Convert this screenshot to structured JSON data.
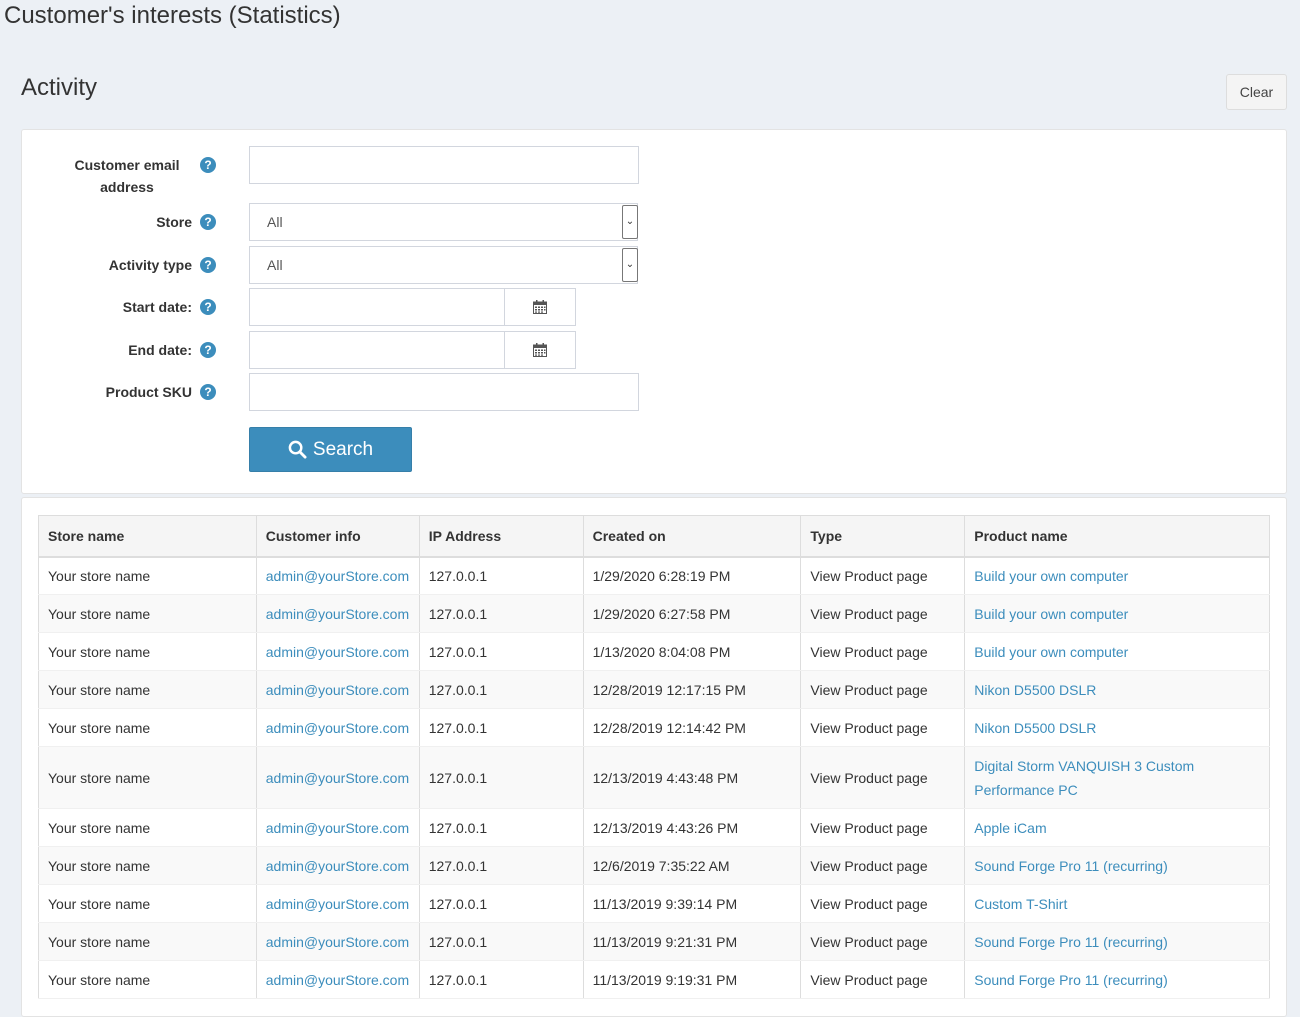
{
  "page": {
    "title": "Customer's interests (Statistics)"
  },
  "section": {
    "title": "Activity",
    "clear_label": "Clear"
  },
  "filters": {
    "email": {
      "label": "Customer email address",
      "value": ""
    },
    "store": {
      "label": "Store",
      "value": "All"
    },
    "activity_type": {
      "label": "Activity type",
      "value": "All"
    },
    "start_date": {
      "label": "Start date:",
      "value": ""
    },
    "end_date": {
      "label": "End date:",
      "value": ""
    },
    "sku": {
      "label": "Product SKU",
      "value": ""
    },
    "search_label": "Search"
  },
  "table": {
    "headers": [
      "Store name",
      "Customer info",
      "IP Address",
      "Created on",
      "Type",
      "Product name"
    ],
    "rows": [
      [
        "Your store name",
        "admin@yourStore.com",
        "127.0.0.1",
        "1/29/2020 6:28:19 PM",
        "View Product page",
        "Build your own computer"
      ],
      [
        "Your store name",
        "admin@yourStore.com",
        "127.0.0.1",
        "1/29/2020 6:27:58 PM",
        "View Product page",
        "Build your own computer"
      ],
      [
        "Your store name",
        "admin@yourStore.com",
        "127.0.0.1",
        "1/13/2020 8:04:08 PM",
        "View Product page",
        "Build your own computer"
      ],
      [
        "Your store name",
        "admin@yourStore.com",
        "127.0.0.1",
        "12/28/2019 12:17:15 PM",
        "View Product page",
        "Nikon D5500 DSLR"
      ],
      [
        "Your store name",
        "admin@yourStore.com",
        "127.0.0.1",
        "12/28/2019 12:14:42 PM",
        "View Product page",
        "Nikon D5500 DSLR"
      ],
      [
        "Your store name",
        "admin@yourStore.com",
        "127.0.0.1",
        "12/13/2019 4:43:48 PM",
        "View Product page",
        "Digital Storm VANQUISH 3 Custom Performance PC"
      ],
      [
        "Your store name",
        "admin@yourStore.com",
        "127.0.0.1",
        "12/13/2019 4:43:26 PM",
        "View Product page",
        "Apple iCam"
      ],
      [
        "Your store name",
        "admin@yourStore.com",
        "127.0.0.1",
        "12/6/2019 7:35:22 AM",
        "View Product page",
        "Sound Forge Pro 11 (recurring)"
      ],
      [
        "Your store name",
        "admin@yourStore.com",
        "127.0.0.1",
        "11/13/2019 9:39:14 PM",
        "View Product page",
        "Custom T-Shirt"
      ],
      [
        "Your store name",
        "admin@yourStore.com",
        "127.0.0.1",
        "11/13/2019 9:21:31 PM",
        "View Product page",
        "Sound Forge Pro 11 (recurring)"
      ],
      [
        "Your store name",
        "admin@yourStore.com",
        "127.0.0.1",
        "11/13/2019 9:19:31 PM",
        "View Product page",
        "Sound Forge Pro 11 (recurring)"
      ]
    ]
  },
  "icons": {
    "help": "question-circle-icon",
    "calendar": "calendar-icon",
    "search": "search-icon"
  },
  "colors": {
    "accent": "#3c8dbc",
    "background": "#ecf0f5"
  }
}
